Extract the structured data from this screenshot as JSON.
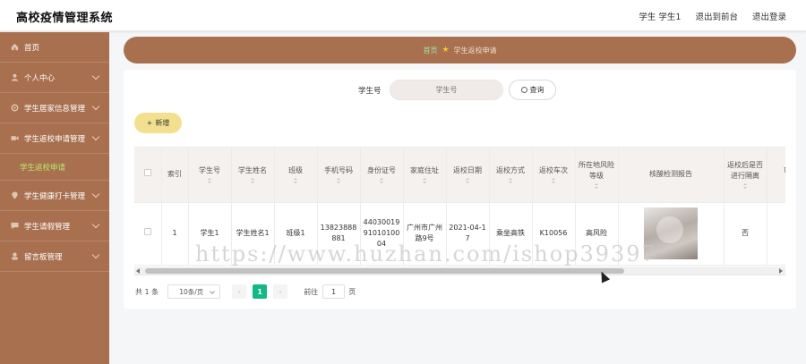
{
  "app": {
    "title": "高校疫情管理系统"
  },
  "top_links": {
    "user": "学生 学生1",
    "back_front": "退出到前台",
    "logout": "退出登录"
  },
  "sidebar": {
    "items": [
      {
        "label": "首页",
        "icon": "home-icon"
      },
      {
        "label": "个人中心",
        "icon": "user-icon"
      },
      {
        "label": "学生居家信息管理",
        "icon": "gear-icon"
      },
      {
        "label": "学生返校申请管理",
        "icon": "video-icon",
        "children": [
          {
            "label": "学生返校申请"
          }
        ]
      },
      {
        "label": "学生健康打卡管理",
        "icon": "pin-icon"
      },
      {
        "label": "学生请假管理",
        "icon": "chat-icon"
      },
      {
        "label": "留言板管理",
        "icon": "person-icon"
      }
    ]
  },
  "breadcrumb": {
    "home": "首页",
    "current": "学生返校申请"
  },
  "search": {
    "label": "学生号",
    "placeholder": "学生号",
    "button": "查询"
  },
  "toolbar": {
    "add_label": "新增",
    "add_prefix": "+"
  },
  "table": {
    "columns": [
      "索引",
      "学生号",
      "学生姓名",
      "班级",
      "手机号码",
      "身份证号",
      "家庭住址",
      "返校日期",
      "返校方式",
      "返校车次",
      "所在地风险等级",
      "核酸检测报告",
      "返校后是否进行隔离",
      "审核"
    ],
    "rows": [
      {
        "index": "1",
        "student_no": "学生1",
        "name": "学生姓名1",
        "class": "班级1",
        "phone": "13823888881",
        "id_card": "440300199101010004",
        "address": "广州市广州路9号",
        "return_date": "2021-04-17",
        "return_mode": "乘坐高铁",
        "train_no": "K10056",
        "risk_level": "高风险",
        "quarantine": "否"
      }
    ]
  },
  "pager": {
    "total": "共 1 条",
    "page_size": "10条/页",
    "prev": "‹",
    "current_page": "1",
    "next": "›",
    "goto_label": "前往",
    "goto_value": "1",
    "goto_unit": "页"
  },
  "watermark": "https://www.huzhan.com/ishop39397",
  "colors": {
    "sidebar": "#a8704f",
    "accent_green": "#12b886",
    "add_button": "#f3e08f"
  }
}
